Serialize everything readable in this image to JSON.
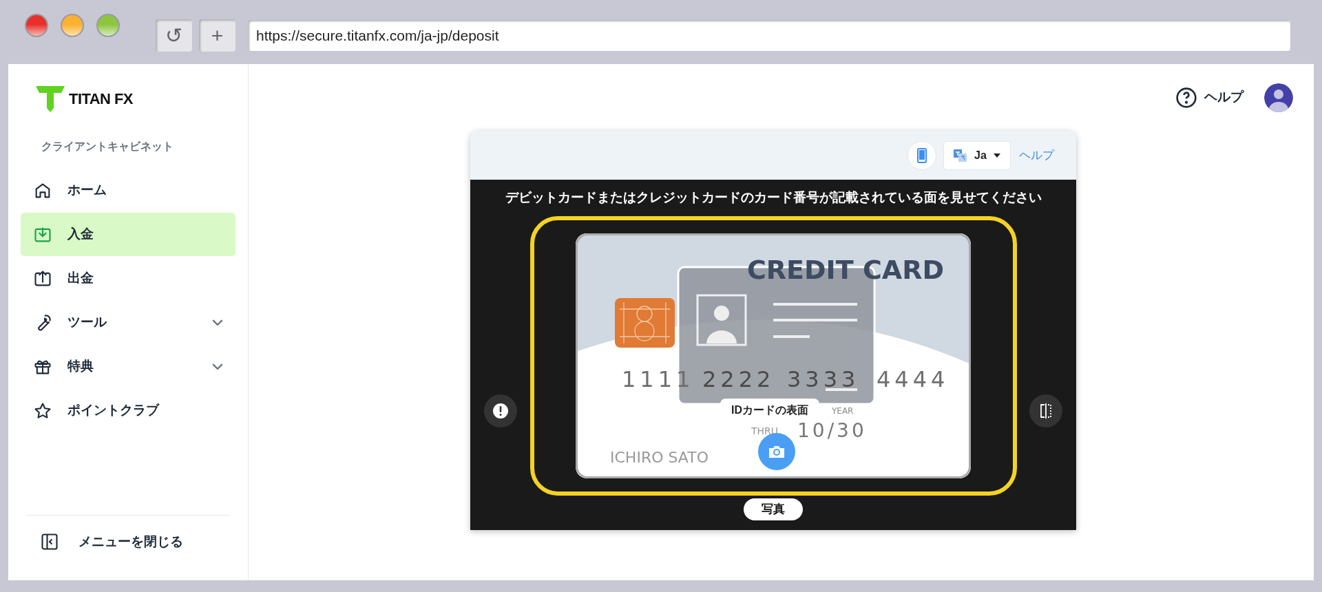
{
  "browser": {
    "url": "https://secure.titanfx.com/ja-jp/deposit",
    "buttons": [
      "↺",
      "+"
    ]
  },
  "sidebar": {
    "logo": "TITAN FX",
    "section_title": "クライアントキャビネット",
    "items": [
      {
        "label": "ホーム",
        "selected": false,
        "expandable": false
      },
      {
        "label": "入金",
        "selected": true,
        "expandable": false
      },
      {
        "label": "出金",
        "selected": false,
        "expandable": false
      },
      {
        "label": "ツール",
        "selected": false,
        "expandable": true
      },
      {
        "label": "特典",
        "selected": false,
        "expandable": true
      },
      {
        "label": "ポイントクラブ",
        "selected": false,
        "expandable": false
      }
    ],
    "collapse": "メニューを閉じる"
  },
  "header": {
    "help": "ヘルプ"
  },
  "verification": {
    "language": "Ja",
    "help": "ヘルプ",
    "instruction": "デビットカードまたはクレジットカードのカード番号が記載されている面を見せてください",
    "guide_card": {
      "title": "CREDIT CARD",
      "number_groups": [
        "1111",
        "2222",
        "3333",
        "4444"
      ],
      "year": "YEAR",
      "thru": "THRU",
      "expiry": "10/30",
      "holder": "ICHIRO SATO",
      "overlay_label": "IDカードの表面"
    },
    "capture_mode": "写真"
  }
}
